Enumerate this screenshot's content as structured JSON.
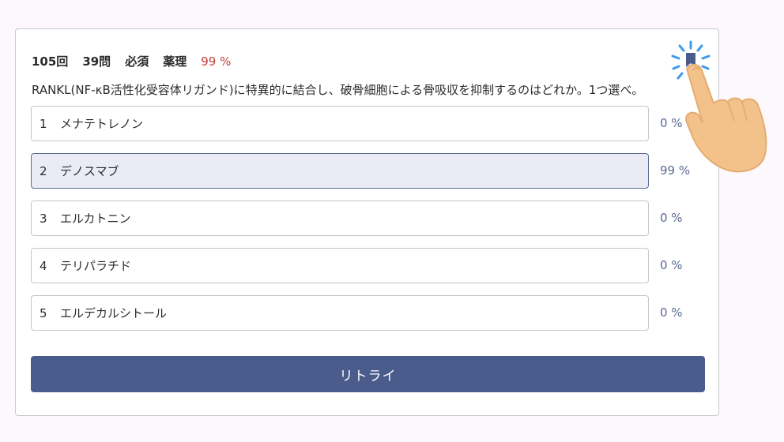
{
  "question": {
    "exam_no": "105回",
    "question_no": "39問",
    "category": "必須",
    "subject": "薬理",
    "correct_rate": "99 %",
    "text": "RANKL(NF-κB活性化受容体リガンド)に特異的に結合し、破骨細胞による骨吸収を抑制するのはどれか。1つ選べ。"
  },
  "options": [
    {
      "number": "1",
      "label": "メナテトレノン",
      "percent": "0 %"
    },
    {
      "number": "2",
      "label": "デノスマブ",
      "percent": "99 %"
    },
    {
      "number": "3",
      "label": "エルカトニン",
      "percent": "0 %"
    },
    {
      "number": "4",
      "label": "テリパラチド",
      "percent": "0 %"
    },
    {
      "number": "5",
      "label": "エルデカルシトール",
      "percent": "0 %"
    }
  ],
  "retry_label": "リトライ",
  "icons": {
    "bookmark": "bookmark-icon",
    "hand": "pointing-hand-icon"
  },
  "colors": {
    "accent": "#4a5c8c",
    "rate": "#c0403c",
    "selected_bg": "#eaebf5"
  }
}
